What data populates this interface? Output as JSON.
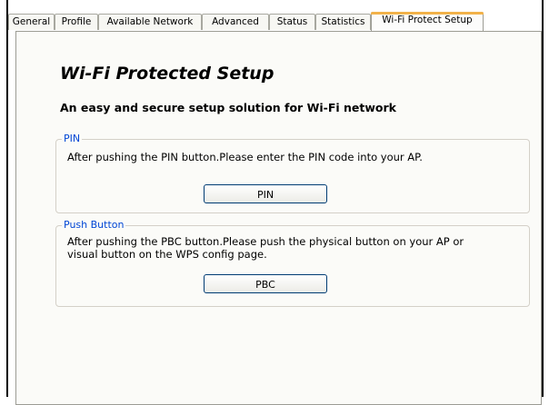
{
  "tabs": [
    {
      "label": "General"
    },
    {
      "label": "Profile"
    },
    {
      "label": "Available Network"
    },
    {
      "label": "Advanced"
    },
    {
      "label": "Status"
    },
    {
      "label": "Statistics"
    },
    {
      "label": "Wi-Fi Protect Setup",
      "active": true
    }
  ],
  "main": {
    "title": "Wi-Fi Protected Setup",
    "subtitle": "An easy and secure setup solution for Wi-Fi network"
  },
  "pin_group": {
    "legend": "PIN",
    "text": "After pushing the PIN button.Please enter the PIN code into your AP.",
    "button_label": "PIN"
  },
  "pbc_group": {
    "legend": "Push Button",
    "text": "After pushing the PBC button.Please push the physical button on your AP or visual button on the WPS config page.",
    "button_label": "PBC"
  },
  "colors": {
    "legend_blue": "#0046d5",
    "active_tab_accent": "#f2b24a",
    "panel_background": "#fbfbf8"
  }
}
